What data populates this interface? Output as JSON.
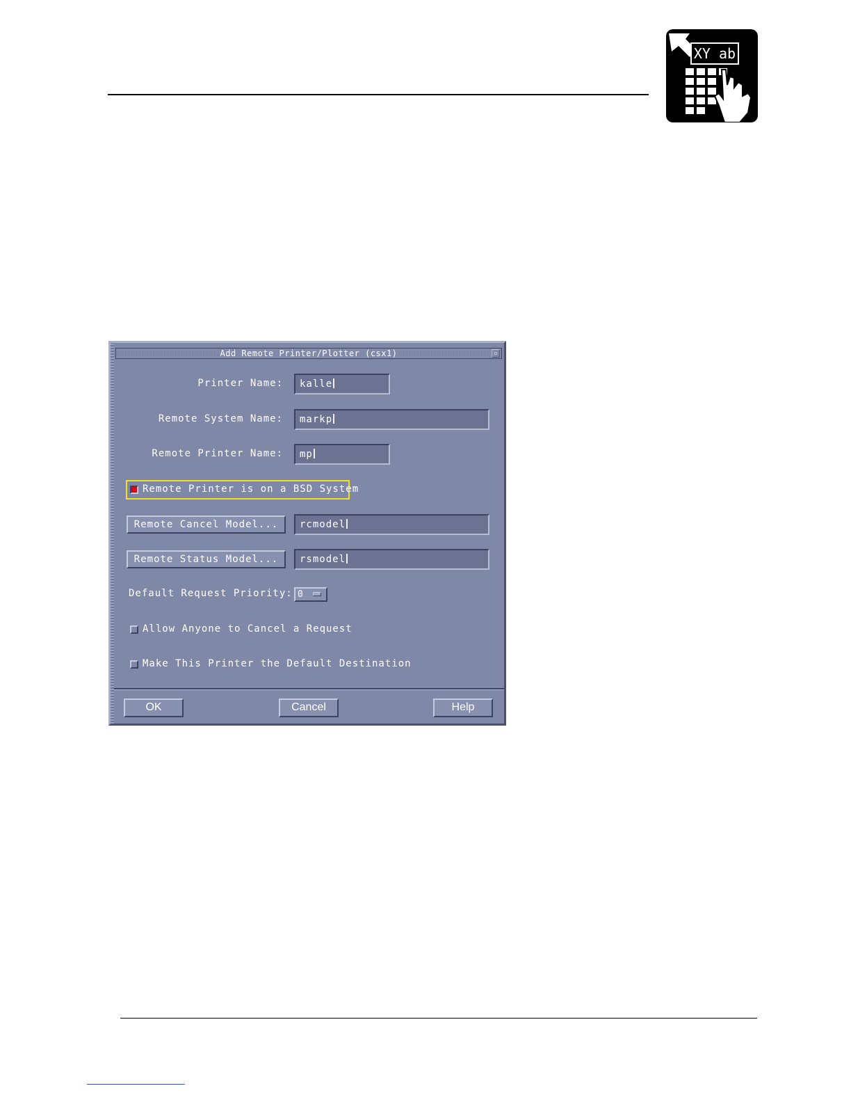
{
  "logo": {
    "icon": "spreadsheet-hand-icon",
    "text": "XY ab"
  },
  "dialog": {
    "title": "Add Remote Printer/Plotter (csx1)",
    "window_menu_glyph": "▫",
    "fields": {
      "printer_name": {
        "label": "Printer Name:",
        "value": "kalle"
      },
      "remote_system_name": {
        "label": "Remote System Name:",
        "value": "markp"
      },
      "remote_printer_name": {
        "label": "Remote Printer Name:",
        "value": "mp"
      }
    },
    "bsd_checkbox": {
      "label": "Remote Printer is on a BSD System",
      "checked": true
    },
    "cancel_model": {
      "button_label": "Remote Cancel Model...",
      "value": "rcmodel"
    },
    "status_model": {
      "button_label": "Remote Status Model...",
      "value": "rsmodel"
    },
    "priority": {
      "label": "Default Request Priority:",
      "value": "0"
    },
    "allow_cancel": {
      "label": "Allow Anyone to Cancel a Request",
      "checked": false
    },
    "default_destination": {
      "label": "Make This Printer the Default Destination",
      "checked": false
    },
    "buttons": {
      "ok": "OK",
      "cancel": "Cancel",
      "help": "Help"
    }
  },
  "colors": {
    "dialog_bg": "#8088a8",
    "highlight": "#f0e020",
    "checked": "#e00018"
  }
}
